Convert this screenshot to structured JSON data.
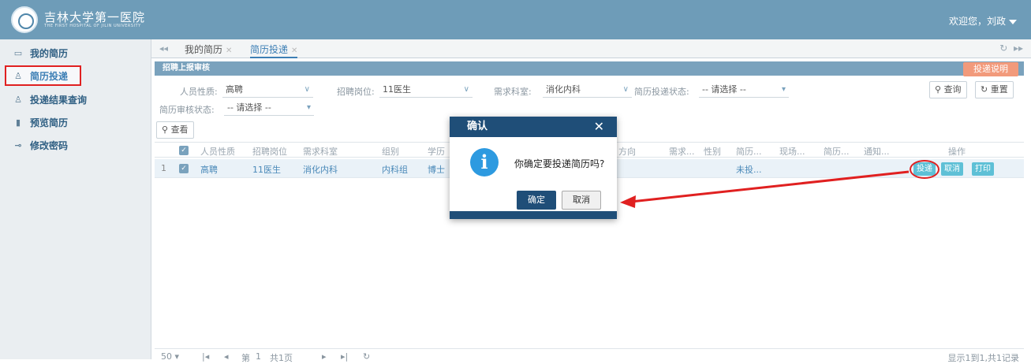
{
  "header": {
    "logo_text": "吉林大学第一医院",
    "logo_sub": "THE FIRST HOSPITAL OF JILIN UNIVERSITY",
    "greeting": "欢迎您，刘政"
  },
  "sidebar": {
    "items": [
      {
        "label": "我的简历",
        "icon": "card-icon"
      },
      {
        "label": "简历投递",
        "icon": "upload-icon"
      },
      {
        "label": "投递结果查询",
        "icon": "upload-icon"
      },
      {
        "label": "预览简历",
        "icon": "preview-icon"
      },
      {
        "label": "修改密码",
        "icon": "lock-icon"
      }
    ]
  },
  "tabs": [
    {
      "label": "我的简历"
    },
    {
      "label": "简历投递"
    }
  ],
  "section": {
    "title": "招聘上报审核",
    "help_button": "投递说明"
  },
  "filters": {
    "person_type_label": "人员性质:",
    "person_type_value": "高聘",
    "position_label": "招聘岗位:",
    "position_value": "11医生",
    "dept_label": "需求科室:",
    "dept_value": "消化内科",
    "status_label": "简历投递状态:",
    "status_value": "-- 请选择 --",
    "audit_label": "简历审核状态:",
    "audit_value": "-- 请选择 --",
    "search_button": "查询",
    "reset_button": "重置",
    "view_button": "查看"
  },
  "grid": {
    "columns": [
      "人员性质",
      "招聘岗位",
      "需求科室",
      "组别",
      "学历",
      "方向",
      "需求...",
      "性别",
      "简历...",
      "现场...",
      "简历...",
      "通知...",
      "操作"
    ],
    "row": {
      "index": "1",
      "person_type": "高聘",
      "position": "11医生",
      "dept": "消化内科",
      "group": "内科组",
      "degree": "博士",
      "resume_status": "未投...",
      "actions": [
        "投递",
        "取消",
        "打印"
      ]
    }
  },
  "pager": {
    "page_size": "50",
    "page_prefix": "第",
    "page_value": "1",
    "page_total": "共1页",
    "summary": "显示1到1,共1记录"
  },
  "dialog": {
    "title": "确认",
    "message": "你确定要投递简历吗?",
    "ok": "确定",
    "cancel": "取消"
  }
}
